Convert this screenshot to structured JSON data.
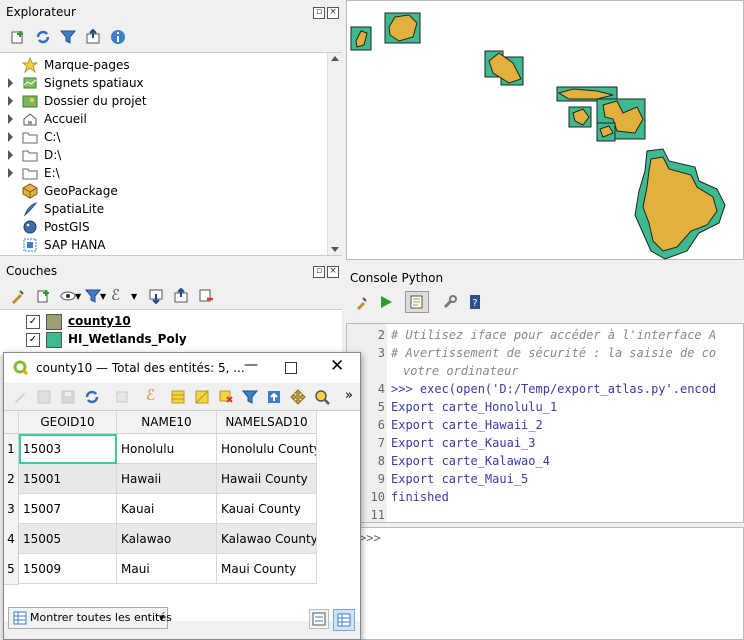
{
  "browser_panel": {
    "title": "Explorateur",
    "items": [
      {
        "label": "Marque-pages",
        "icon": "star-icon",
        "arrow": false
      },
      {
        "label": "Signets spatiaux",
        "icon": "spatial-bookmarks-icon",
        "arrow": true
      },
      {
        "label": "Dossier du projet",
        "icon": "project-folder-icon",
        "arrow": true
      },
      {
        "label": "Accueil",
        "icon": "home-icon",
        "arrow": true
      },
      {
        "label": "C:\\",
        "icon": "folder-icon",
        "arrow": true
      },
      {
        "label": "D:\\",
        "icon": "folder-icon",
        "arrow": true
      },
      {
        "label": "E:\\",
        "icon": "folder-icon",
        "arrow": true
      },
      {
        "label": "GeoPackage",
        "icon": "geopackage-icon",
        "arrow": false
      },
      {
        "label": "SpatiaLite",
        "icon": "spatialite-icon",
        "arrow": false
      },
      {
        "label": "PostGIS",
        "icon": "postgis-icon",
        "arrow": false
      },
      {
        "label": "SAP HANA",
        "icon": "sap-hana-icon",
        "arrow": false
      }
    ]
  },
  "layers_panel": {
    "title": "Couches",
    "layers": [
      {
        "name": "county10",
        "color": "#9e9e74",
        "checked": true
      },
      {
        "name": "HI_Wetlands_Poly",
        "color": "#3dbb8e",
        "checked": true
      }
    ]
  },
  "map": {
    "fill_color": "#e2b03c",
    "wetland_color": "#3dbb8e"
  },
  "python_console": {
    "title": "Console Python",
    "lines": [
      {
        "n": "2",
        "text": "# Utilisez iface pour accéder à l'interface A"
      },
      {
        "n": "3",
        "text": "# Avertissement de sécurité : la saisie de co"
      },
      {
        "n": "",
        "text": "votre ordinateur"
      },
      {
        "n": "4",
        "text": ">>> exec(open('D:/Temp/export_atlas.py'.encod"
      },
      {
        "n": "5",
        "text": "Export carte_Honolulu_1"
      },
      {
        "n": "6",
        "text": "Export carte_Hawaii_2"
      },
      {
        "n": "7",
        "text": "Export carte_Kauai_3"
      },
      {
        "n": "8",
        "text": "Export carte_Kalawao_4"
      },
      {
        "n": "9",
        "text": "Export carte_Maui_5"
      },
      {
        "n": "10",
        "text": "finished"
      },
      {
        "n": "11",
        "text": ""
      }
    ],
    "prompt": ">>>"
  },
  "attribute_table": {
    "title": "county10 — Total des entités: 5, ...",
    "columns": [
      "GEOID10",
      "NAME10",
      "NAMELSAD10"
    ],
    "rows": [
      [
        "15003",
        "Honolulu",
        "Honolulu County"
      ],
      [
        "15001",
        "Hawaii",
        "Hawaii County"
      ],
      [
        "15007",
        "Kauai",
        "Kauai County"
      ],
      [
        "15005",
        "Kalawao",
        "Kalawao County"
      ],
      [
        "15009",
        "Maui",
        "Maui County"
      ]
    ],
    "row_numbers": [
      "1",
      "2",
      "3",
      "4",
      "5"
    ],
    "filter_button": "Montrer toutes les entités"
  }
}
